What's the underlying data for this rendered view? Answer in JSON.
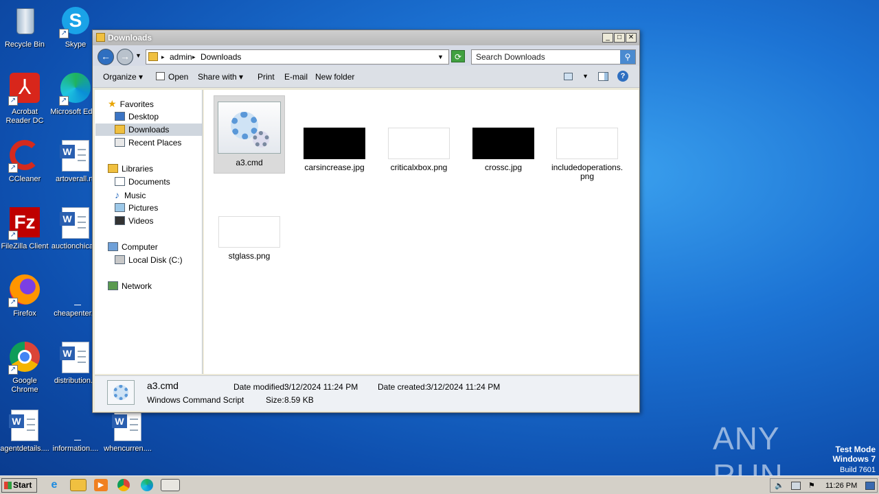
{
  "desktop": {
    "icons": [
      {
        "label": "Recycle Bin"
      },
      {
        "label": "Skype"
      },
      {
        "label": "Acrobat Reader DC"
      },
      {
        "label": "Microsoft Edge"
      },
      {
        "label": "CCleaner"
      },
      {
        "label": "artoverall.rtf"
      },
      {
        "label": "FileZilla Client"
      },
      {
        "label": "auctionchica..."
      },
      {
        "label": "Firefox"
      },
      {
        "label": "cheapenter..."
      },
      {
        "label": "Google Chrome"
      },
      {
        "label": "distribution..."
      },
      {
        "label": "agentdetails...."
      },
      {
        "label": "information...."
      },
      {
        "label": "whencurren...."
      }
    ]
  },
  "window": {
    "title": "Downloads",
    "address": {
      "crumb1": "admin",
      "crumb2": "Downloads"
    },
    "search_placeholder": "Search Downloads",
    "toolbar": {
      "organize": "Organize",
      "open": "Open",
      "share_with": "Share with",
      "print": "Print",
      "email": "E-mail",
      "new_folder": "New folder"
    },
    "nav": {
      "favorites": "Favorites",
      "desktop": "Desktop",
      "downloads": "Downloads",
      "recent_places": "Recent Places",
      "libraries": "Libraries",
      "documents": "Documents",
      "music": "Music",
      "pictures": "Pictures",
      "videos": "Videos",
      "computer": "Computer",
      "local_disk": "Local Disk (C:)",
      "network": "Network"
    },
    "files": [
      {
        "name": "a3.cmd"
      },
      {
        "name": "carsincrease.jpg"
      },
      {
        "name": "criticalxbox.png"
      },
      {
        "name": "crossc.jpg"
      },
      {
        "name": "includedoperations.png"
      },
      {
        "name": "stglass.png"
      }
    ],
    "details": {
      "name": "a3.cmd",
      "type": "Windows Command Script",
      "date_modified_label": "Date modified:",
      "date_modified": "3/12/2024 11:24 PM",
      "date_created_label": "Date created:",
      "date_created": "3/12/2024 11:24 PM",
      "size_label": "Size:",
      "size": "8.59 KB"
    }
  },
  "taskbar": {
    "start": "Start",
    "clock": "11:26 PM"
  },
  "watermark": {
    "brand": "ANY RUN",
    "line1": "Test Mode",
    "line2": "Windows 7",
    "line3": "Build 7601"
  }
}
